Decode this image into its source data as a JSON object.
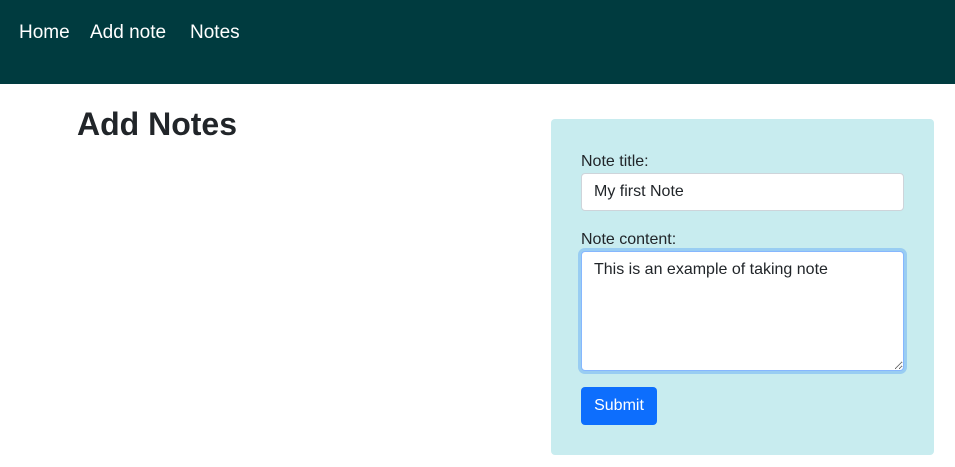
{
  "navbar": {
    "background_color": "#003b3f",
    "items": [
      {
        "label": "Home"
      },
      {
        "label": "Add note"
      },
      {
        "label": "Notes"
      }
    ]
  },
  "main": {
    "title": "Add Notes"
  },
  "form": {
    "panel_color": "#c8ecef",
    "title_label": "Note title:",
    "title_value": "My first Note",
    "content_label": "Note content:",
    "content_value": "This is an example of taking note",
    "submit_label": "Submit",
    "submit_color": "#0d6efd"
  }
}
